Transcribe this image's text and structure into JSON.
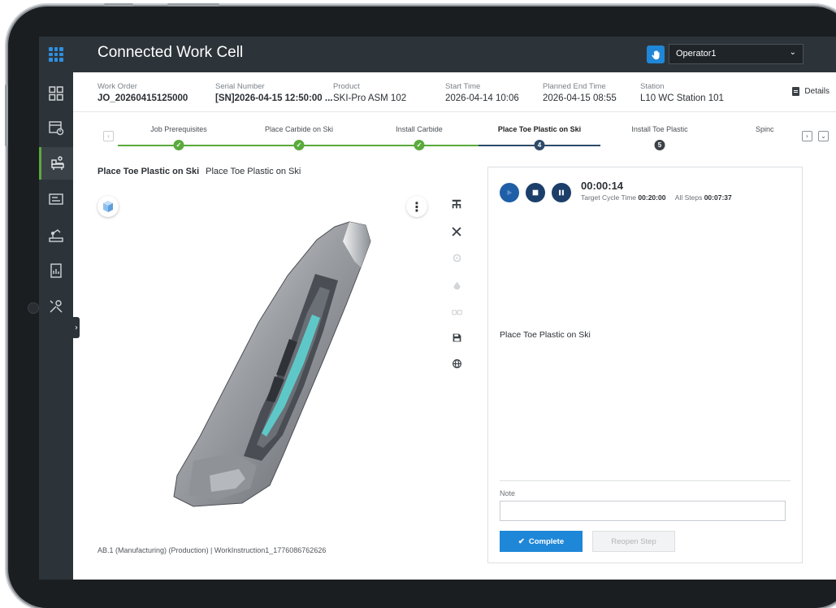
{
  "app": {
    "title": "Connected Work Cell",
    "operator": "Operator1"
  },
  "info": {
    "work_order": {
      "label": "Work Order",
      "value": "JO_20260415125000"
    },
    "serial": {
      "label": "Serial Number",
      "value": "[SN]2026-04-15 12:50:00 ..."
    },
    "product": {
      "label": "Product",
      "value": "SKI-Pro ASM 102"
    },
    "start": {
      "label": "Start Time",
      "value": "2026-04-14 10:06"
    },
    "planned_end": {
      "label": "Planned End Time",
      "value": "2026-04-15 08:55"
    },
    "station": {
      "label": "Station",
      "value": "L10 WC Station 101"
    },
    "details_label": "Details"
  },
  "steps": [
    {
      "label": "Job Prerequisites",
      "state": "done"
    },
    {
      "label": "Place Carbide on Ski",
      "state": "done"
    },
    {
      "label": "Install Carbide",
      "state": "done"
    },
    {
      "label": "Place Toe Plastic on Ski",
      "state": "current",
      "number": "4"
    },
    {
      "label": "Install Toe Plastic",
      "state": "pending",
      "number": "5"
    },
    {
      "label": "Spinc",
      "state": "pending"
    }
  ],
  "content": {
    "crumb_bold": "Place Toe Plastic on Ski",
    "crumb": "Place Toe Plastic on Ski",
    "footer": "AB.1 (Manufacturing) (Production) | WorkInstruction1_1776086762626"
  },
  "panel": {
    "timer": "00:00:14",
    "target_label": "Target Cycle Time",
    "target_value": "00:20:00",
    "all_label": "All Steps",
    "all_value": "00:07:37",
    "step_text": "Place Toe Plastic on Ski",
    "note_label": "Note",
    "complete_label": "Complete",
    "reopen_label": "Reopen Step"
  },
  "colors": {
    "accent": "#1f87d8",
    "done": "#5aaa3c",
    "current": "#2d4a6a",
    "rail": "#2d3439"
  }
}
